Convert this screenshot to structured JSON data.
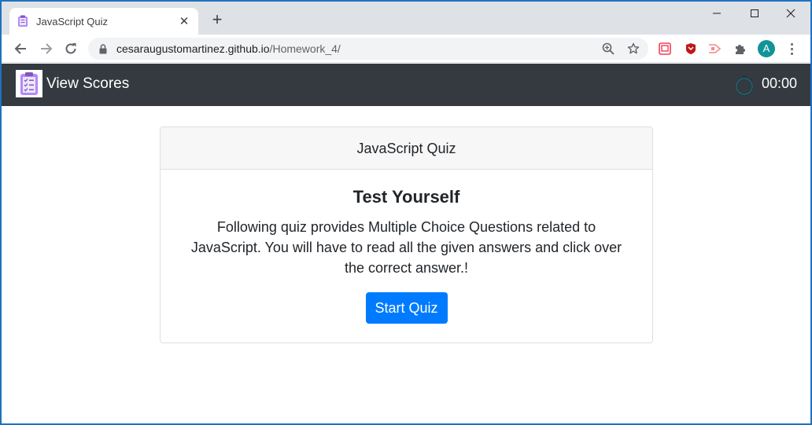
{
  "browser": {
    "tab_title": "JavaScript Quiz",
    "tab_close": "✕",
    "new_tab": "+",
    "url_host": "cesaraugustomartinez.github.io",
    "url_path": "/Homework_4/",
    "profile_initial": "A"
  },
  "navbar": {
    "view_scores_label": "View Scores",
    "timer": "00:00"
  },
  "card": {
    "header": "JavaScript Quiz",
    "title": "Test Yourself",
    "text": "Following quiz provides Multiple Choice Questions related to JavaScript. You will have to read all the given answers and click over the correct answer.!",
    "start_button_label": "Start Quiz"
  },
  "colors": {
    "navbar_bg": "#343a40",
    "primary_button": "#007bff",
    "card_header_bg": "#f7f7f7",
    "tabstrip_bg": "#dee1e6"
  },
  "icons": [
    "clipboard-icon",
    "close-icon",
    "plus-icon",
    "minimize-icon",
    "maximize-icon",
    "back-arrow-icon",
    "forward-arrow-icon",
    "reload-icon",
    "lock-icon",
    "zoom-icon",
    "star-icon",
    "pocket-icon",
    "mcafee-icon",
    "cast-icon",
    "puzzle-icon",
    "menu-icon",
    "timer-icon"
  ]
}
